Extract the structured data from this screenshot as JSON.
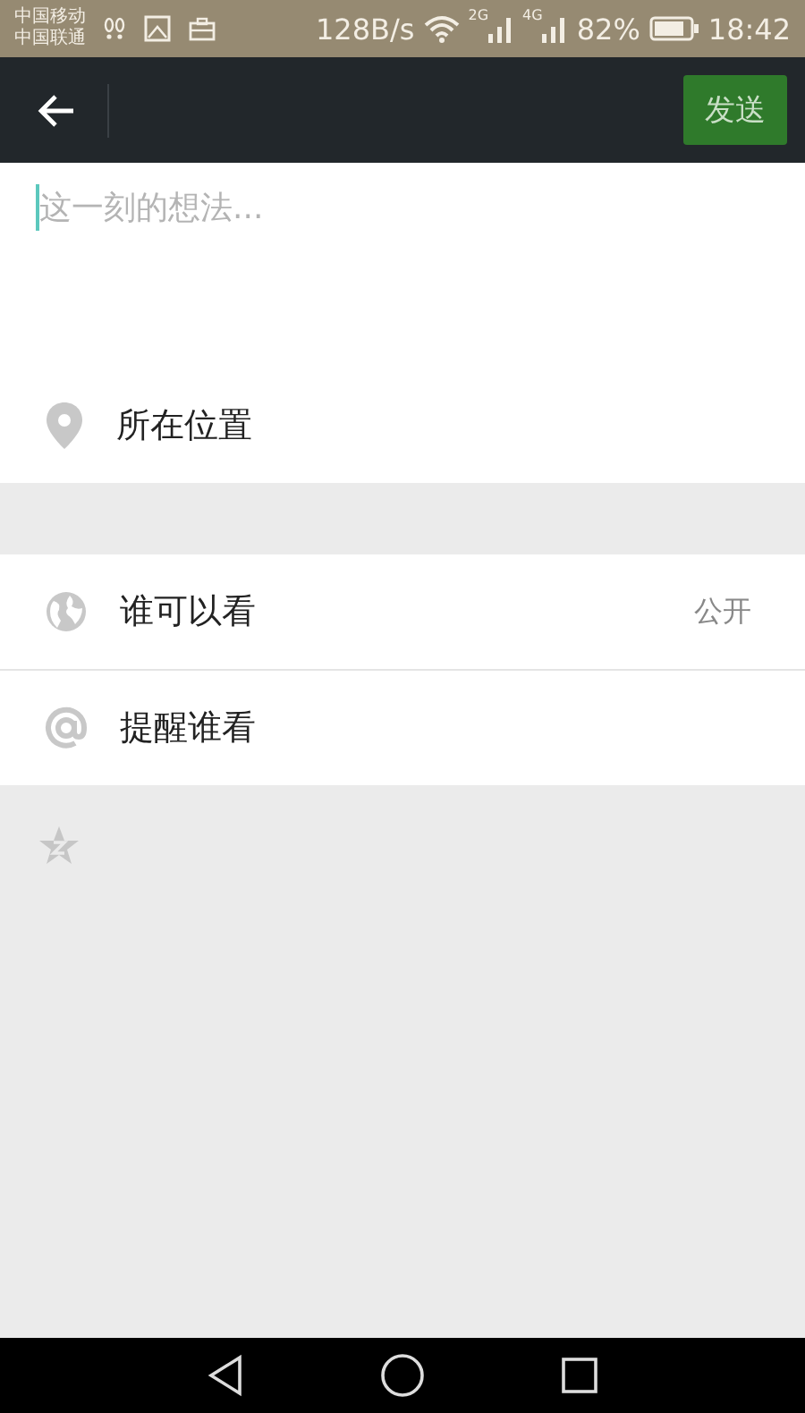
{
  "status_bar": {
    "carriers": [
      "中国移动",
      "中国联通"
    ],
    "speed": "128B/s",
    "networks": [
      "2G",
      "4G"
    ],
    "battery": "82%",
    "time": "18:42"
  },
  "toolbar": {
    "send_button": "发送"
  },
  "composer": {
    "placeholder": "这一刻的想法..."
  },
  "location": {
    "label": "所在位置"
  },
  "options": [
    {
      "kind": "globe",
      "label": "谁可以看",
      "value": "公开"
    },
    {
      "kind": "at",
      "label": "提醒谁看"
    }
  ]
}
